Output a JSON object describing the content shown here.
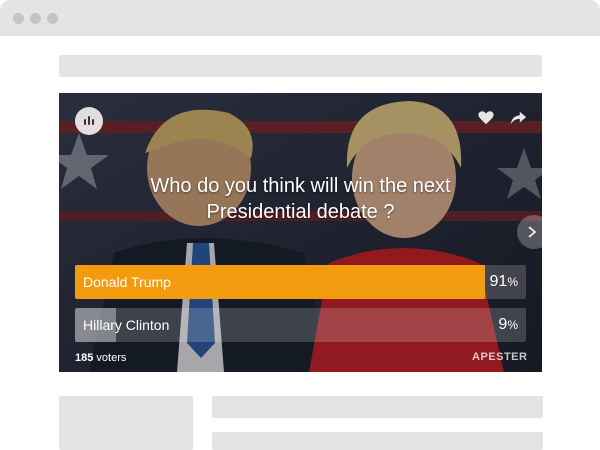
{
  "poll": {
    "question": "Who do you think will win the next Presidential debate ?",
    "answers": [
      {
        "label": "Donald Trump",
        "percent": 91,
        "fill_color": "#f29b0f"
      },
      {
        "label": "Hillary Clinton",
        "percent": 9,
        "fill_color": "rgba(255,255,255,0.35)"
      }
    ],
    "percent_sign": "%",
    "voter_count": "185",
    "voter_label": "voters",
    "brand": "APESTER"
  },
  "icons": {
    "logo": "apester-logo-icon",
    "like": "heart-icon",
    "share": "share-icon",
    "next": "chevron-right-icon"
  },
  "colors": {
    "accent": "#f29b0f",
    "placeholder": "#e4e4e4",
    "browser_dots": "#c4c4c4"
  }
}
